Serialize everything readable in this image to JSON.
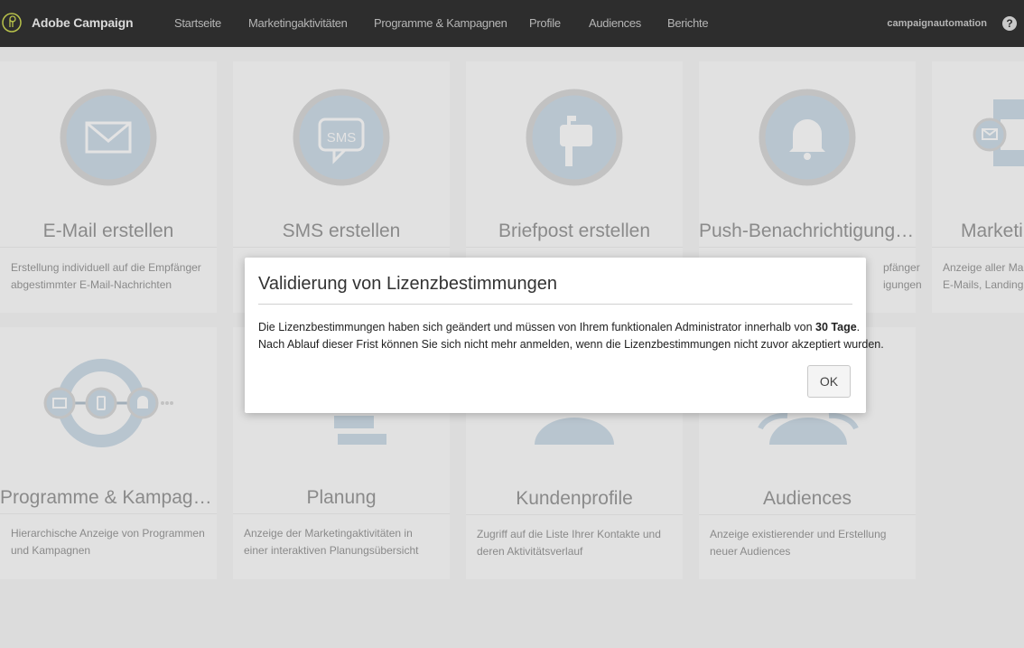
{
  "header": {
    "app_title": "Adobe Campaign",
    "nav": [
      "Startseite",
      "Marketingaktivitäten",
      "Programme & Kampagnen",
      "Profile",
      "Audiences",
      "Berichte"
    ],
    "user": "campaignautomation",
    "help_label": "?"
  },
  "cards": [
    {
      "title": "E-Mail erstellen",
      "desc": [
        "Erstellung individuell auf die Empfänger",
        "abgestimmter E-Mail-Nachrichten"
      ],
      "icon": "email-icon"
    },
    {
      "title": "SMS erstellen",
      "desc": [],
      "icon": "sms-icon",
      "icon_text": "SMS"
    },
    {
      "title": "Briefpost erstellen",
      "desc": [],
      "icon": "mailbox-icon"
    },
    {
      "title": "Push-Benachrichtigung er...",
      "desc": [
        "pfänger",
        "igungen"
      ],
      "icon": "bell-icon"
    },
    {
      "title": "Marketin",
      "desc": [
        "Anzeige aller Ma",
        "E-Mails, Landing"
      ],
      "icon": "marketing-activities-icon"
    },
    {
      "title": "Programme & Kampagnen",
      "desc": [
        "Hierarchische Anzeige von Programmen",
        "und Kampagnen"
      ],
      "icon": "programs-icon"
    },
    {
      "title": "Planung",
      "desc": [
        "Anzeige der Marketingaktivitäten in",
        "einer interaktiven Planungsübersicht"
      ],
      "icon": "planning-icon"
    },
    {
      "title": "Kundenprofile",
      "desc": [
        "Zugriff auf die Liste Ihrer Kontakte und",
        "deren Aktivitätsverlauf"
      ],
      "icon": "profile-icon"
    },
    {
      "title": "Audiences",
      "desc": [
        "Anzeige existierender und Erstellung",
        "neuer Audiences"
      ],
      "icon": "audiences-icon"
    }
  ],
  "modal": {
    "title": "Validierung von Lizenzbestimmungen",
    "body_line1_pre": "Die Lizenzbestimmungen haben sich geändert und müssen von Ihrem funktionalen Administrator innerhalb von ",
    "body_line1_bold": "30 Tage",
    "body_line1_post": ".",
    "body_line2": "Nach Ablauf dieser Frist können Sie sich nicht mehr anmelden, wenn die Lizenzbestimmungen nicht zuvor akzeptiert wurden.",
    "ok_label": "OK"
  },
  "colors": {
    "topbar": "#2d2d2d",
    "icon_blue": "#a9c2d7",
    "icon_ring": "#bdbdbd",
    "overlay": "rgba(200,200,200,0.5)"
  }
}
